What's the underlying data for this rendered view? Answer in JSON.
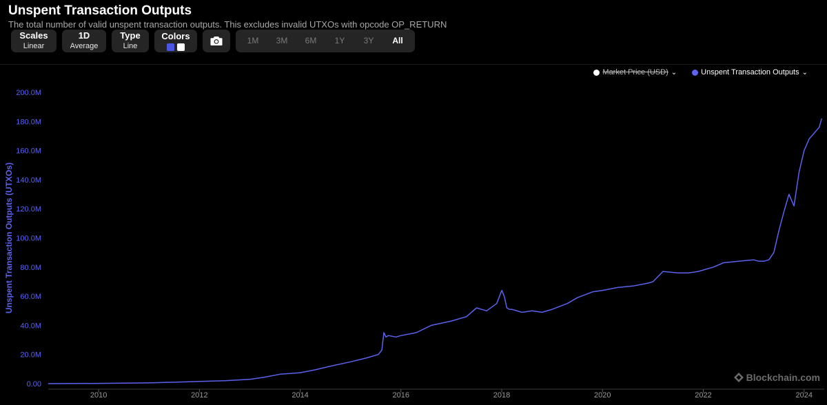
{
  "header": {
    "title": "Unspent Transaction Outputs",
    "subtitle": "The total number of valid unspent transaction outputs. This excludes invalid UTXOs with opcode OP_RETURN"
  },
  "toolbar": {
    "scales_label": "Scales",
    "scales_value": "Linear",
    "interval_label": "1D",
    "interval_value": "Average",
    "type_label": "Type",
    "type_value": "Line",
    "colors_label": "Colors",
    "color_swatches": [
      "#4a56e2",
      "#ffffff"
    ],
    "camera_icon": "camera-icon",
    "ranges": [
      "1M",
      "3M",
      "6M",
      "1Y",
      "3Y",
      "All"
    ],
    "active_range": "All"
  },
  "legend": {
    "market_price": "Market Price (USD)",
    "market_price_color": "#ffffff",
    "utxo": "Unspent Transaction Outputs",
    "utxo_color": "#5b63f0"
  },
  "watermark": "Blockchain.com",
  "chart_data": {
    "type": "line",
    "ylabel": "Unspent Transaction Outputs (UTXOs)",
    "ylim": [
      0,
      200000000
    ],
    "xlim": [
      2009.0,
      2024.4
    ],
    "yticks": [
      {
        "value": 0,
        "label": "0.00"
      },
      {
        "value": 20000000,
        "label": "20.0M"
      },
      {
        "value": 40000000,
        "label": "40.0M"
      },
      {
        "value": 60000000,
        "label": "60.0M"
      },
      {
        "value": 80000000,
        "label": "80.0M"
      },
      {
        "value": 100000000,
        "label": "100.0M"
      },
      {
        "value": 120000000,
        "label": "120.0M"
      },
      {
        "value": 140000000,
        "label": "140.0M"
      },
      {
        "value": 160000000,
        "label": "160.0M"
      },
      {
        "value": 180000000,
        "label": "180.0M"
      },
      {
        "value": 200000000,
        "label": "200.0M"
      }
    ],
    "xticks": [
      {
        "value": 2010,
        "label": "2010"
      },
      {
        "value": 2012,
        "label": "2012"
      },
      {
        "value": 2014,
        "label": "2014"
      },
      {
        "value": 2016,
        "label": "2016"
      },
      {
        "value": 2018,
        "label": "2018"
      },
      {
        "value": 2020,
        "label": "2020"
      },
      {
        "value": 2022,
        "label": "2022"
      },
      {
        "value": 2024,
        "label": "2024"
      }
    ],
    "grid": false,
    "legend_position": "top-right",
    "series": [
      {
        "name": "Unspent Transaction Outputs",
        "color": "#5b63f0",
        "x": [
          2009.0,
          2010.0,
          2011.0,
          2011.5,
          2012.0,
          2012.5,
          2013.0,
          2013.3,
          2013.6,
          2013.8,
          2014.0,
          2014.3,
          2014.6,
          2015.0,
          2015.3,
          2015.55,
          2015.62,
          2015.66,
          2015.7,
          2015.75,
          2015.9,
          2016.0,
          2016.3,
          2016.6,
          2017.0,
          2017.3,
          2017.5,
          2017.7,
          2017.9,
          2018.0,
          2018.05,
          2018.1,
          2018.15,
          2018.2,
          2018.4,
          2018.6,
          2018.8,
          2019.0,
          2019.3,
          2019.5,
          2019.8,
          2020.0,
          2020.3,
          2020.6,
          2020.9,
          2021.0,
          2021.2,
          2021.5,
          2021.7,
          2021.9,
          2022.2,
          2022.4,
          2022.7,
          2023.0,
          2023.1,
          2023.2,
          2023.3,
          2023.4,
          2023.5,
          2023.6,
          2023.7,
          2023.8,
          2023.9,
          2024.0,
          2024.1,
          2024.2,
          2024.3,
          2024.35
        ],
        "values": [
          0,
          200000,
          500000,
          1000000,
          1500000,
          2000000,
          3000000,
          4500000,
          6500000,
          7000000,
          7500000,
          9500000,
          12000000,
          15000000,
          17500000,
          20000000,
          23000000,
          35000000,
          32000000,
          33000000,
          32000000,
          33000000,
          35000000,
          40000000,
          43000000,
          46000000,
          52000000,
          50000000,
          55000000,
          64000000,
          60000000,
          52000000,
          51000000,
          51000000,
          49000000,
          50000000,
          49000000,
          51000000,
          55000000,
          59000000,
          63000000,
          64000000,
          66000000,
          67000000,
          69000000,
          70000000,
          77000000,
          76000000,
          76000000,
          77000000,
          80000000,
          83000000,
          84000000,
          85000000,
          84000000,
          84000000,
          85000000,
          90000000,
          105000000,
          118000000,
          130000000,
          122000000,
          145000000,
          160000000,
          168000000,
          172000000,
          176000000,
          182000000
        ]
      }
    ]
  }
}
